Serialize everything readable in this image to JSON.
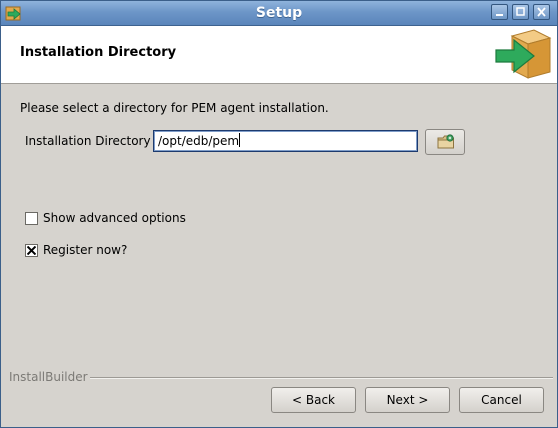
{
  "window": {
    "title": "Setup",
    "app_icon": "installer-arrow-icon",
    "controls": [
      "minimize-icon",
      "maximize-icon",
      "close-icon"
    ]
  },
  "header": {
    "title": "Installation Directory",
    "logo_icon": "package-arrow-icon"
  },
  "content": {
    "instruction": "Please select a directory for PEM agent installation.",
    "directory_label": "Installation Directory",
    "directory_value": "/opt/edb/pem",
    "browse_icon": "folder-browse-icon",
    "show_advanced": {
      "label": "Show advanced options",
      "checked": false
    },
    "register_now": {
      "label": "Register now?",
      "checked": true
    }
  },
  "footer": {
    "brand": "InstallBuilder",
    "back_label": "< Back",
    "next_label": "Next >",
    "cancel_label": "Cancel"
  },
  "colors": {
    "titlebar": "#6d96c8",
    "window_bg": "#d6d3ce",
    "header_bg": "#ffffff",
    "logo_box": "#e8b45a",
    "logo_arrow": "#2eaa5c"
  }
}
